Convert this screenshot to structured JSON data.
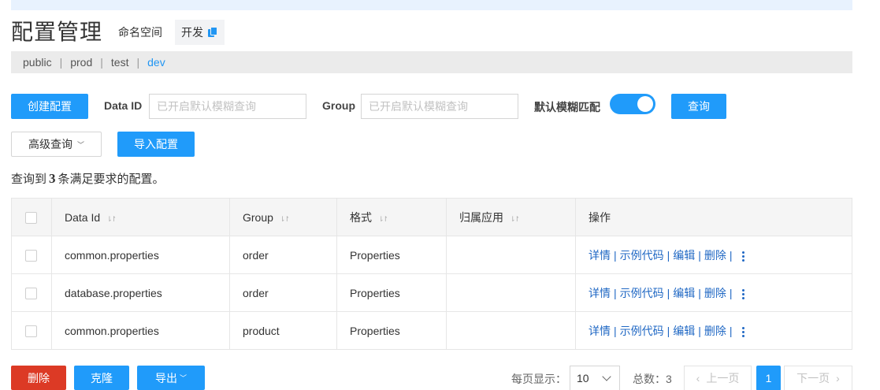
{
  "header": {
    "title": "配置管理",
    "namespace_label": "命名空间",
    "namespace_value": "开发",
    "copy_icon": "copy-icon"
  },
  "namespaces": [
    {
      "label": "public",
      "active": false
    },
    {
      "label": "prod",
      "active": false
    },
    {
      "label": "test",
      "active": false
    },
    {
      "label": "dev",
      "active": true
    }
  ],
  "toolbar": {
    "create_label": "创建配置",
    "data_id_label": "Data ID",
    "data_id_placeholder": "已开启默认模糊查询",
    "group_label": "Group",
    "group_placeholder": "已开启默认模糊查询",
    "fuzzy_label": "默认模糊匹配",
    "fuzzy_on": true,
    "search_label": "查询",
    "advanced_label": "高级查询",
    "import_label": "导入配置"
  },
  "result": {
    "prefix": "查询到",
    "count": "3",
    "suffix": "条满足要求的配置。"
  },
  "table": {
    "columns": [
      "Data Id",
      "Group",
      "格式",
      "归属应用",
      "操作"
    ],
    "rows": [
      {
        "data_id": "common.properties",
        "group": "order",
        "format": "Properties",
        "app": ""
      },
      {
        "data_id": "database.properties",
        "group": "order",
        "format": "Properties",
        "app": ""
      },
      {
        "data_id": "common.properties",
        "group": "product",
        "format": "Properties",
        "app": ""
      }
    ],
    "actions": {
      "detail": "详情",
      "sample": "示例代码",
      "edit": "编辑",
      "delete": "删除",
      "sep": "|"
    }
  },
  "footer": {
    "delete_label": "删除",
    "clone_label": "克隆",
    "export_label": "导出",
    "page_size_label": "每页显示：",
    "page_size_value": "10",
    "total_label": "总数：3",
    "prev_label": "上一页",
    "current_page": "1",
    "next_label": "下一页"
  },
  "colors": {
    "primary": "#209bfa",
    "danger": "#dc3a25",
    "link": "#2068c4",
    "active_ns": "#2196f3"
  }
}
